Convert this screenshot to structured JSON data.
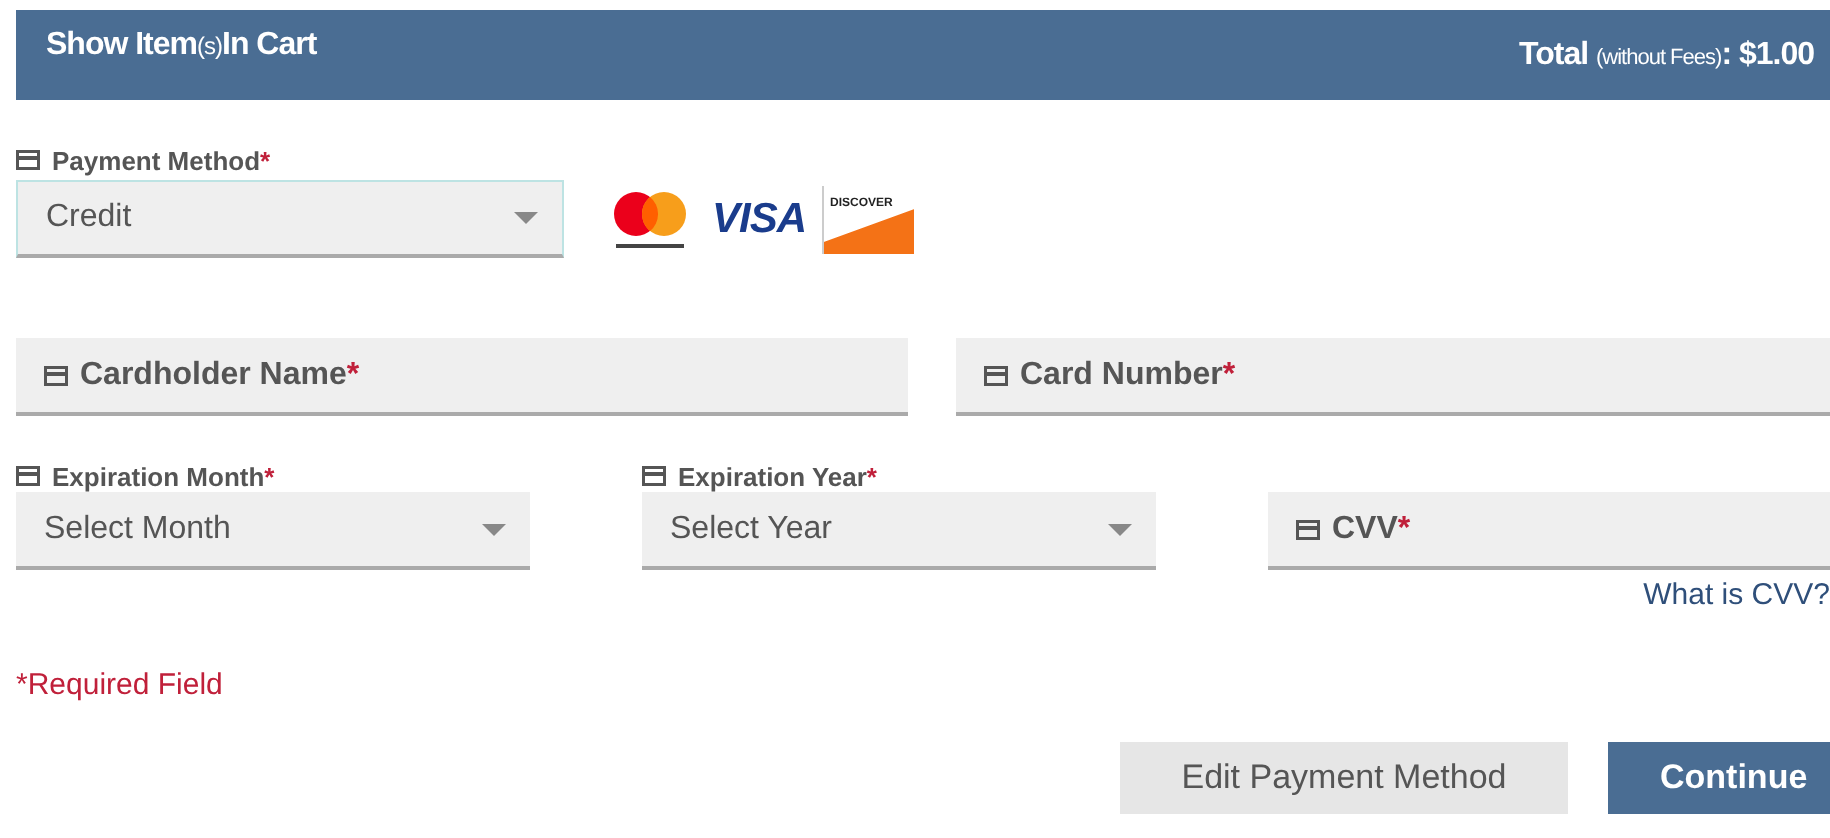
{
  "header": {
    "cart_toggle": [
      {
        "text": "Show Item",
        "kind": "main"
      },
      {
        "text": "(s)",
        "kind": "aside"
      },
      {
        "text": "In Cart",
        "kind": "main"
      }
    ],
    "total": [
      {
        "text": "Total ",
        "kind": "main"
      },
      {
        "text": "(without Fees)",
        "kind": "aside"
      },
      {
        "text": ": $1.00",
        "kind": "main"
      }
    ]
  },
  "payment_method": {
    "label": "Payment Method",
    "mark": "*",
    "value": "Credit",
    "focused": true
  },
  "card_logos": [
    {
      "kind": "mastercard"
    },
    {
      "kind": "visa",
      "text": "VISA"
    },
    {
      "kind": "discover",
      "text": "DISCOVER"
    }
  ],
  "rows": [
    [
      {
        "kind": "text",
        "label": "Cardholder Name",
        "mark": "*"
      },
      {
        "kind": "text",
        "label": "Card Number",
        "mark": "*"
      }
    ],
    [
      {
        "kind": "select",
        "label": "Expiration Month",
        "mark": "*",
        "value": "Select Month"
      },
      {
        "kind": "select",
        "label": "Expiration Year",
        "mark": "*",
        "value": "Select Year"
      },
      {
        "kind": "text",
        "label": "CVV",
        "mark": "*",
        "link": "What is CVV?"
      }
    ]
  ],
  "required_note": "*Required Field",
  "buttons": [
    {
      "kind": "secondary",
      "label": "Edit Payment Method"
    },
    {
      "kind": "primary",
      "label": "Continue"
    }
  ]
}
